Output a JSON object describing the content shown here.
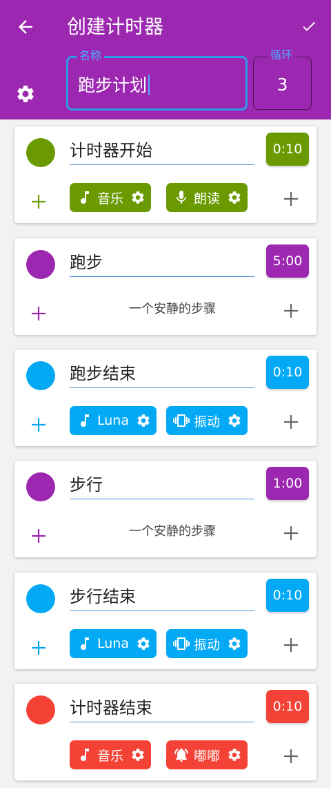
{
  "header": {
    "title": "创建计时器",
    "name_label": "名称",
    "name_value": "跑步计划",
    "loop_label": "循环",
    "loop_value": "3",
    "icons": {
      "back": "arrow-left-icon",
      "confirm": "check-icon",
      "settings": "gear-icon"
    }
  },
  "quiet_label": "一个安静的步骤",
  "colors": {
    "header": "#9c27b0",
    "green": "#6a9a00",
    "purple": "#9c27b0",
    "blue": "#03a9f4",
    "red": "#f44336"
  },
  "steps": [
    {
      "name": "计时器开始",
      "duration": "0:10",
      "color": "#6a9a00",
      "chips": [
        {
          "icon": "music-note-icon",
          "label": "音乐"
        },
        {
          "icon": "microphone-icon",
          "label": "朗读"
        }
      ]
    },
    {
      "name": "跑步",
      "duration": "5:00",
      "color": "#9c27b0",
      "chips": []
    },
    {
      "name": "跑步结束",
      "duration": "0:10",
      "color": "#03a9f4",
      "chips": [
        {
          "icon": "music-note-icon",
          "label": "Luna"
        },
        {
          "icon": "vibrate-icon",
          "label": "振动"
        }
      ]
    },
    {
      "name": "步行",
      "duration": "1:00",
      "color": "#9c27b0",
      "chips": []
    },
    {
      "name": "步行结束",
      "duration": "0:10",
      "color": "#03a9f4",
      "chips": [
        {
          "icon": "music-note-icon",
          "label": "Luna"
        },
        {
          "icon": "vibrate-icon",
          "label": "振动"
        }
      ]
    },
    {
      "name": "计时器结束",
      "duration": "0:10",
      "color": "#f44336",
      "chips": [
        {
          "icon": "music-note-icon",
          "label": "音乐"
        },
        {
          "icon": "bell-icon",
          "label": "嘟嘟"
        }
      ]
    }
  ]
}
